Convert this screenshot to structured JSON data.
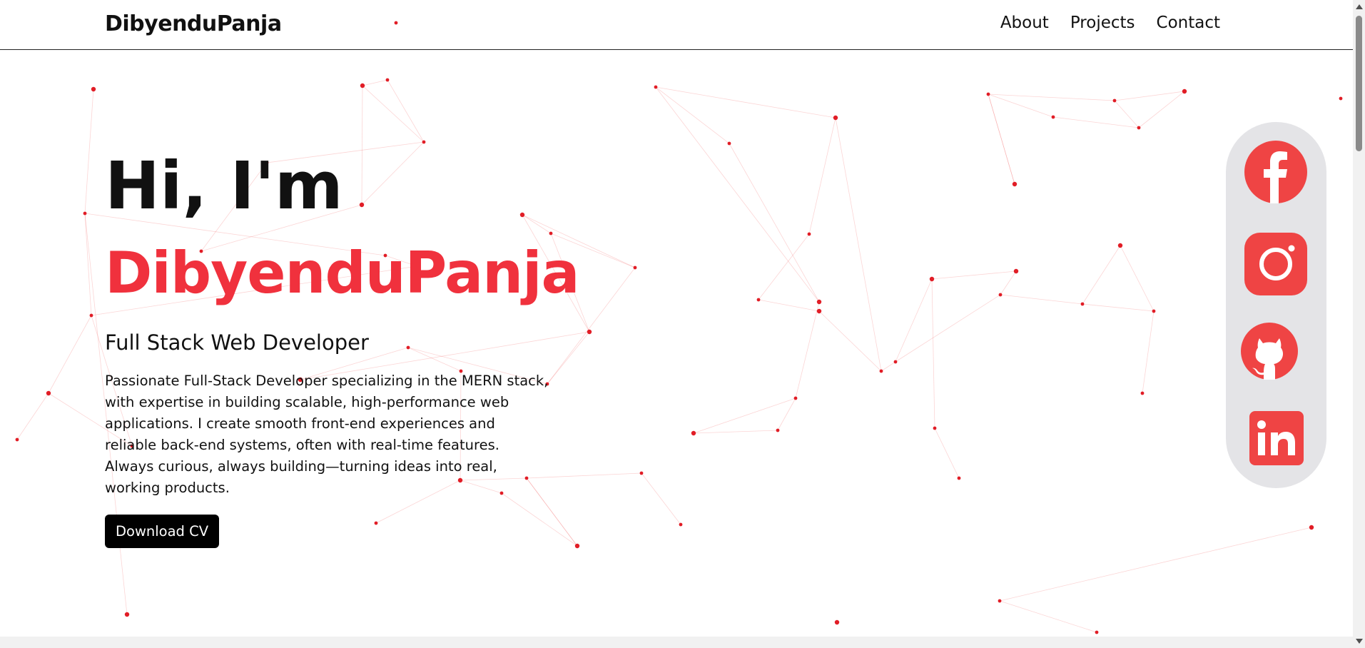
{
  "nav": {
    "brand": "DibyenduPanja",
    "links": [
      "About",
      "Projects",
      "Contact"
    ]
  },
  "hero": {
    "greeting": "Hi, I'm",
    "name": "DibyenduPanja",
    "role": "Full Stack Web Developer",
    "description": "Passionate Full-Stack Developer specializing in the MERN stack, with expertise in building scalable, high-performance web applications. I create smooth front-end experiences and reliable back-end systems, often with real-time features. Always curious, always building—turning ideas into real, working products.",
    "cta_label": "Download CV"
  },
  "social": {
    "icons": [
      "facebook-icon",
      "instagram-icon",
      "github-icon",
      "linkedin-icon"
    ]
  },
  "colors": {
    "accent": "#f0313d",
    "icon": "#ef4444",
    "panel": "#e4e4e7",
    "button": "#000000"
  }
}
